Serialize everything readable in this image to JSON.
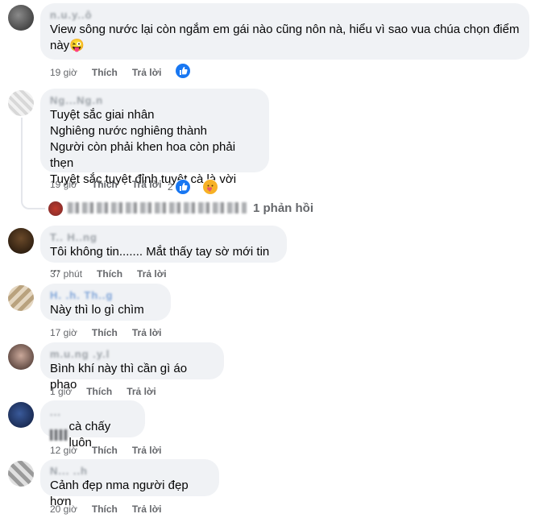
{
  "actions": {
    "like": "Thích",
    "reply": "Trả lời"
  },
  "comments": [
    {
      "author": "n.u.y..ô",
      "text_lines": [
        "View sông nước lại còn ngắm em gái nào cũng nôn nà, hiểu vì sao vua chúa chọn điểm",
        "này😜"
      ],
      "time": "19 giờ",
      "reaction_count": ""
    },
    {
      "author": "Ng...Ng.n",
      "text_lines": [
        "Tuyệt sắc giai nhân",
        "Nghiêng nước nghiêng thành",
        "Người còn phải khen hoa còn phải thẹn",
        "Tuyệt sắc tuyệt đỉnh tuyệt cà là vời"
      ],
      "time": "19 giờ",
      "reaction_count": "2"
    },
    {
      "author": "T.. H..ng",
      "text_lines": [
        "Tôi không tin....... Mắt thấy tay sờ mới tin ..."
      ],
      "time": "37 phút",
      "reaction_count": ""
    },
    {
      "author": "H. .h. Th..g",
      "text_lines": [
        "Này thì lo gì chìm"
      ],
      "time": "17 giờ",
      "reaction_count": ""
    },
    {
      "author": "m.u.ng .y.l",
      "text_lines": [
        "Bình khí này thì cần gì áo phao"
      ],
      "time": "1 giờ",
      "reaction_count": ""
    },
    {
      "author": "...",
      "text_lines": [
        " cà chấy luôn"
      ],
      "time": "12 giờ",
      "reaction_count": ""
    },
    {
      "author": "N... ..h",
      "text_lines": [
        "Cảnh đẹp nma người đẹp hơn"
      ],
      "time": "20 giờ",
      "reaction_count": ""
    }
  ],
  "reply_summary": {
    "count_label": "1 phản hồi"
  }
}
